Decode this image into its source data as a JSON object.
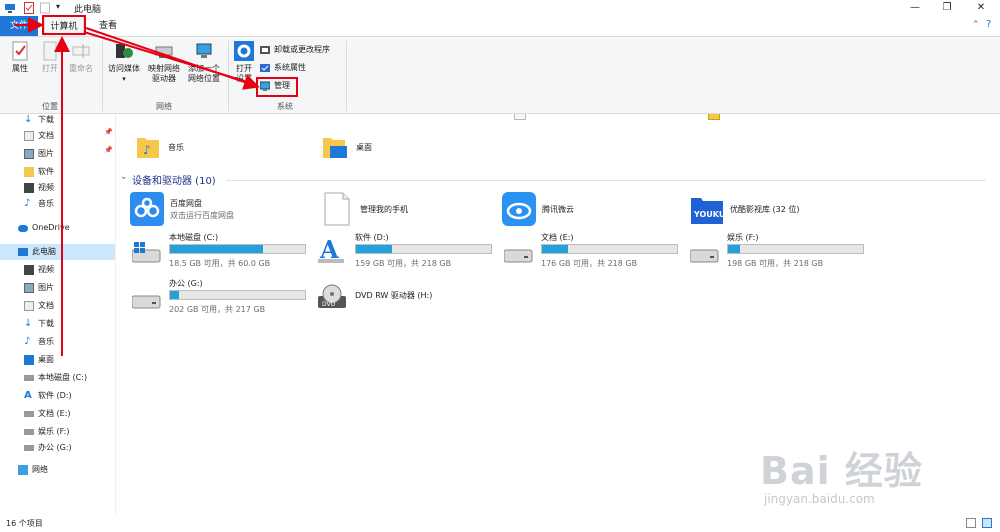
{
  "window": {
    "title": "此电脑",
    "minimize": "—",
    "restore": "❐",
    "close": "✕"
  },
  "tabs": {
    "file": "文件",
    "computer": "计算机",
    "view": "查看"
  },
  "ribbon": {
    "location_group": "位置",
    "properties": "属性",
    "open": "打开",
    "rename": "重命名",
    "network_group": "网络",
    "access_media": "访问媒体",
    "map_drive_line1": "映射网络",
    "map_drive_line2": "驱动器",
    "add_location_line1": "添加一个",
    "add_location_line2": "网络位置",
    "system_group": "系统",
    "open_settings_line1": "打开",
    "open_settings_line2": "设置",
    "uninstall": "卸载或更改程序",
    "system_properties": "系统属性",
    "manage": "管理"
  },
  "nav": {
    "quick": [
      {
        "label": "下载"
      },
      {
        "label": "文档"
      },
      {
        "label": "图片"
      },
      {
        "label": "软件"
      },
      {
        "label": "视频"
      },
      {
        "label": "音乐"
      }
    ],
    "onedrive": "OneDrive",
    "this_pc": "此电脑",
    "pc_items": [
      {
        "label": "视频"
      },
      {
        "label": "图片"
      },
      {
        "label": "文档"
      },
      {
        "label": "下载"
      },
      {
        "label": "音乐"
      },
      {
        "label": "桌面"
      },
      {
        "label": "本地磁盘 (C:)"
      },
      {
        "label": "软件 (D:)"
      },
      {
        "label": "文档 (E:)"
      },
      {
        "label": "娱乐 (F:)"
      },
      {
        "label": "办公 (G:)"
      }
    ],
    "network": "网络"
  },
  "folders": {
    "music": "音乐",
    "desktop": "桌面"
  },
  "devices": {
    "header": "设备和驱动器 (10)",
    "apps": [
      {
        "name": "百度网盘",
        "sub": "双击运行百度网盘"
      },
      {
        "name": "管理我的手机",
        "sub": ""
      },
      {
        "name": "腾讯微云",
        "sub": ""
      },
      {
        "name": "优酷影视库 (32 位)",
        "sub": ""
      }
    ],
    "drives": [
      {
        "name": "本地磁盘 (C:)",
        "free": "18.5 GB 可用，共 60.0 GB",
        "used_fraction": 0.69
      },
      {
        "name": "软件 (D:)",
        "free": "159 GB 可用，共 218 GB",
        "used_fraction": 0.27
      },
      {
        "name": "文档 (E:)",
        "free": "176 GB 可用，共 218 GB",
        "used_fraction": 0.19
      },
      {
        "name": "娱乐 (F:)",
        "free": "198 GB 可用，共 218 GB",
        "used_fraction": 0.09
      },
      {
        "name": "办公 (G:)",
        "free": "202 GB 可用，共 217 GB",
        "used_fraction": 0.07
      },
      {
        "name": "DVD RW 驱动器 (H:)",
        "free": ""
      }
    ]
  },
  "status": {
    "count": "16 个项目"
  },
  "watermark": {
    "brand": "Bai 经验",
    "url": "jingyan.baidu.com"
  },
  "colors": {
    "accent": "#1e78d7",
    "drive_fill": "#26a0da",
    "annotation": "#e60012"
  }
}
